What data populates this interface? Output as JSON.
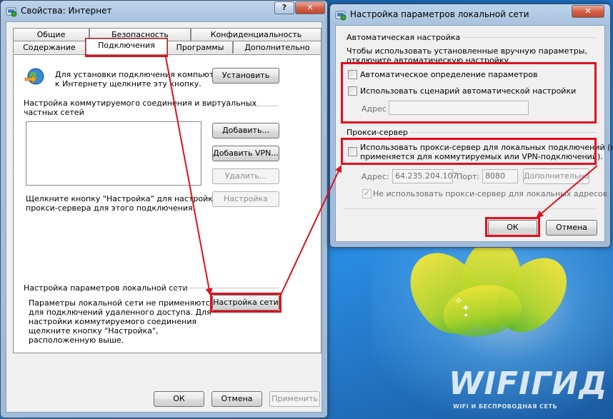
{
  "colors": {
    "highlight": "#e0101e",
    "desktop": "#1d72c4",
    "window_frame": "#a9c3df"
  },
  "watermark": {
    "brand": "WIFIГИД",
    "subtitle": "WIFI И БЕСПРОВОДНАЯ СЕТЬ"
  },
  "internet_properties": {
    "title": "Свойства: Интернет",
    "icon": "internet-options-icon",
    "help_glyph": "?",
    "close_glyph": "✕",
    "tabs_row1": [
      "Общие",
      "Безопасность",
      "Конфиденциальность"
    ],
    "tabs_row2": [
      "Содержание",
      "Подключения",
      "Программы",
      "Дополнительно"
    ],
    "setup": {
      "icon": "network-globe-icon",
      "text_line1": "Для установки подключения компьютера",
      "text_line2": "к Интернету щелкните эту кнопку.",
      "button": "Установить"
    },
    "dialup": {
      "heading_line1": "Настройка коммутируемого соединения и виртуальных",
      "heading_line2": "частных сетей",
      "add_button": "Добавить...",
      "add_vpn_button": "Добавить VPN...",
      "remove_button": "Удалить...",
      "settings_button": "Настройка",
      "hint_line1": "Щелкните кнопку \"Настройка\" для настройки",
      "hint_line2": "прокси-сервера для этого подключения."
    },
    "lan": {
      "heading": "Настройка параметров локальной сети",
      "text_line1": "Параметры локальной сети не применяются",
      "text_line2": "для подключений удаленного доступа. Для",
      "text_line3": "настройки коммутируемого соединения",
      "text_line4": "щелкните кнопку \"Настройка\",",
      "text_line5": "расположенную выше.",
      "button": "Настройка сети"
    },
    "footer": {
      "ok": "ОК",
      "cancel": "Отмена",
      "apply": "Применить"
    }
  },
  "lan_settings": {
    "title": "Настройка параметров локальной сети",
    "icon": "lan-settings-icon",
    "close_glyph": "✕",
    "auto": {
      "group_title": "Автоматическая настройка",
      "desc_line1": "Чтобы использовать установленные вручную параметры,",
      "desc_line2": "отключите автоматическую настройку.",
      "auto_detect": "Автоматическое определение параметров",
      "auto_detect_checked": false,
      "use_script": "Использовать сценарий автоматической настройки",
      "use_script_checked": false,
      "address_label": "Адрес",
      "address_value": ""
    },
    "proxy": {
      "group_title": "Прокси-сервер",
      "use_proxy_line1": "Использовать прокси-сервер для локальных подключений (не",
      "use_proxy_line2": "применяется для коммутируемых или VPN-подключений).",
      "use_proxy_checked": false,
      "address_label": "Адрес:",
      "address_value": "64.235.204.107",
      "port_label": "Порт:",
      "port_value": "8080",
      "advanced_button": "Дополнительно",
      "bypass_local": "Не использовать прокси-сервер для локальных адресов",
      "bypass_local_checked": true
    },
    "footer": {
      "ok": "ОК",
      "cancel": "Отмена"
    }
  }
}
